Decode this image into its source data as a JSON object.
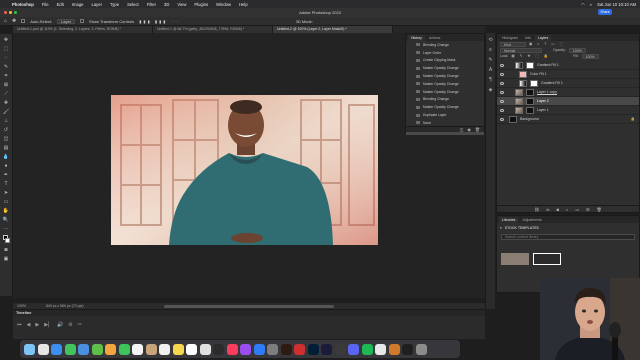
{
  "menubar": {
    "app": "Photoshop",
    "items": [
      "File",
      "Edit",
      "Image",
      "Layer",
      "Type",
      "Select",
      "Filter",
      "3D",
      "View",
      "Plugins",
      "Window",
      "Help"
    ],
    "datetime": "Sat Jun 10  10:10 AM"
  },
  "titlebar": {
    "title": "Adobe Photoshop 2023",
    "share_label": "Share"
  },
  "options": {
    "auto_select_label": "Auto-Select:",
    "auto_select_value": "Layer",
    "transform_label": "Show Transform Controls",
    "mode_label": "3D Mode:"
  },
  "tabs": [
    {
      "label": "Untitled-1.psd @ 110% (1. Selecting, 2. Layers, 3. Filters, RGB/8) *"
    },
    {
      "label": "Untitled-1 @ 66.7% (getty_481292845_77896, RGB/8) *"
    },
    {
      "label": "Untitled-2 @ 100% (Layer 2, Layer Mask/8) *"
    }
  ],
  "history": {
    "tabs": [
      "History",
      "Actions"
    ],
    "items": [
      "Blending Change",
      "Layer Order",
      "Create Clipping Mask",
      "Master Opacity Change",
      "Master Opacity Change",
      "Master Opacity Change",
      "Master Opacity Change",
      "Blending Change",
      "Master Opacity Change",
      "Duplicate Layer",
      "None",
      "None"
    ]
  },
  "layers_panel": {
    "tabs": [
      "Histogram",
      "Info",
      "Layers"
    ],
    "kind_label": "Kind",
    "blend_mode": "Normal",
    "opacity_label": "Opacity:",
    "opacity_value": "100%",
    "lock_label": "Lock:",
    "fill_label": "Fill:",
    "fill_value": "100%",
    "layers": [
      {
        "name": "Gradient Fill 1",
        "thumb": "grad",
        "mask": true
      },
      {
        "name": "Color Fill 1",
        "thumb": "pink",
        "mask": false
      },
      {
        "name": "Gradient Fill 1",
        "thumb": "grad",
        "mask": true
      },
      {
        "name": "Layer 1 copy",
        "thumb": "photo",
        "mask": true
      },
      {
        "name": "Layer 2",
        "thumb": "photo",
        "mask": true
      },
      {
        "name": "Layer 1",
        "thumb": "photo",
        "mask": true
      },
      {
        "name": "Background",
        "thumb": "dark",
        "mask": false
      }
    ],
    "selected_index": 4
  },
  "libraries": {
    "tabs": [
      "Libraries",
      "Adjustments"
    ],
    "section": "STOCK TEMPLATES",
    "search_placeholder": "Search current library"
  },
  "status": {
    "zoom": "100%",
    "dimensions": "840 px x 560 px (72 ppi)"
  },
  "timeline": {
    "title": "Timeline"
  },
  "colors": {
    "accent": "#2d6be5",
    "selection": "#494949"
  }
}
